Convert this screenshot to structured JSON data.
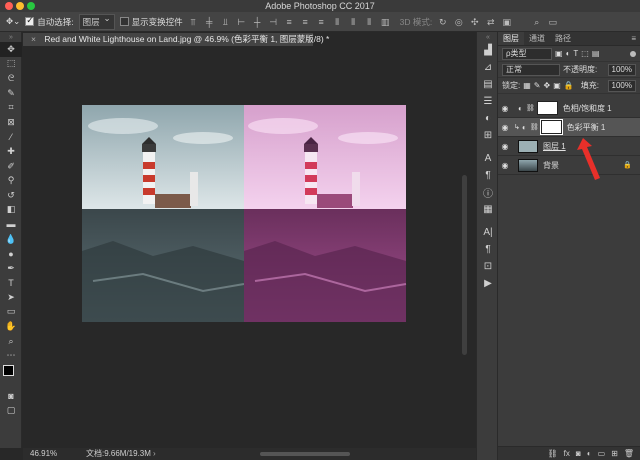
{
  "window": {
    "title": "Adobe Photoshop CC 2017"
  },
  "options_bar": {
    "auto_select_label": "自动选择:",
    "auto_select_value": "图层",
    "show_transform_label": "显示变换控件",
    "mode_3d_label": "3D 模式:"
  },
  "document_tab": {
    "close": "×",
    "title": "Red and White Lighthouse on Land.jpg @ 46.9% (色彩平衡 1, 图层蒙版/8) *"
  },
  "status_bar": {
    "zoom": "46.91%",
    "doc_size": "文档:9.66M/19.3M"
  },
  "layers_panel": {
    "tabs": [
      "图层",
      "通道",
      "路径"
    ],
    "filter_label": "ρ类型",
    "blend_mode": "正常",
    "opacity_label": "不透明度:",
    "opacity_value": "100%",
    "lock_label": "锁定:",
    "fill_label": "填充:",
    "fill_value": "100%",
    "layers": [
      {
        "name": "色相/饱和度 1"
      },
      {
        "name": "色彩平衡 1"
      },
      {
        "name": "图层 1"
      },
      {
        "name": "背景"
      }
    ],
    "bottom_fx": "fx"
  },
  "colors": {
    "arrow": "#e8302a",
    "tint_left": "#5a9aa8",
    "tint_right": "#c848a8"
  }
}
